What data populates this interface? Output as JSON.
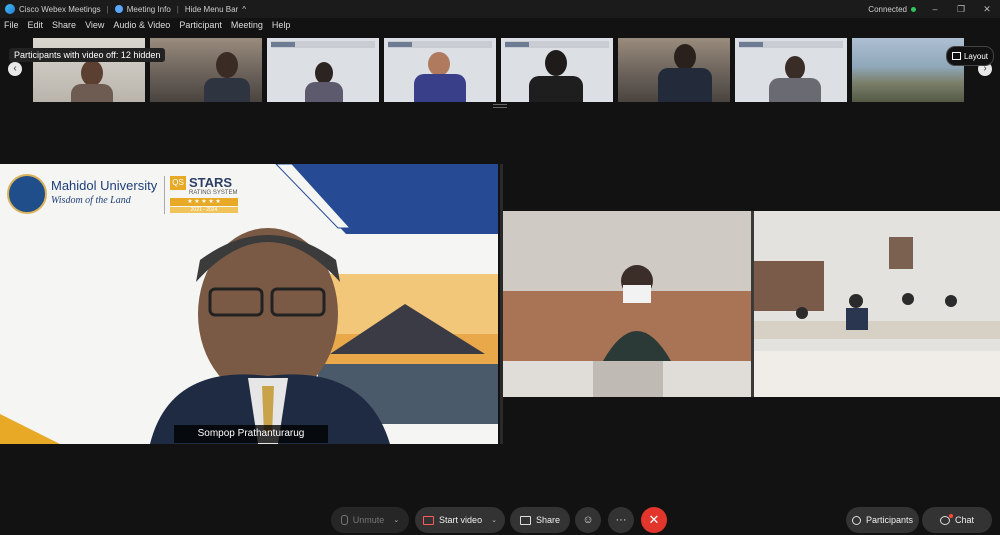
{
  "titlebar": {
    "app_name": "Cisco Webex Meetings",
    "sep1": "|",
    "meeting_info": "Meeting Info",
    "sep2": "|",
    "hide_menu": "Hide Menu Bar",
    "hide_menu_caret": "^",
    "status": "Connected",
    "minimize": "–",
    "restore": "❐",
    "close": "✕"
  },
  "menu": [
    "File",
    "Edit",
    "Share",
    "View",
    "Audio & Video",
    "Participant",
    "Meeting",
    "Help"
  ],
  "filmstrip": {
    "tooltip": "Participants with video off: 12 hidden",
    "layout_label": "Layout",
    "left_arrow": "‹",
    "right_arrow": "›"
  },
  "speaker": {
    "name": "Sompop Prathanturarug",
    "university": "Mahidol University",
    "tagline": "Wisdom of the Land",
    "qs_logo": "QS",
    "qs_stars": "STARS",
    "qs_rating": "RATING SYSTEM",
    "qs_stars_glyphs": "★ ★ ★ ★ ★",
    "qs_year": "2021 - 2024"
  },
  "toolbar": {
    "unmute": "Unmute",
    "start_video": "Start video",
    "share": "Share",
    "reactions_icon": "☺",
    "more_icon": "···",
    "end_icon": "✕",
    "participants": "Participants",
    "chat": "Chat",
    "caret": "⌄"
  },
  "colors": {
    "background": "#121212",
    "end_call": "#e2362c",
    "mahidol_blue": "#1e3f7a",
    "qs_gold": "#e8a927",
    "connected": "#2fc55a"
  }
}
